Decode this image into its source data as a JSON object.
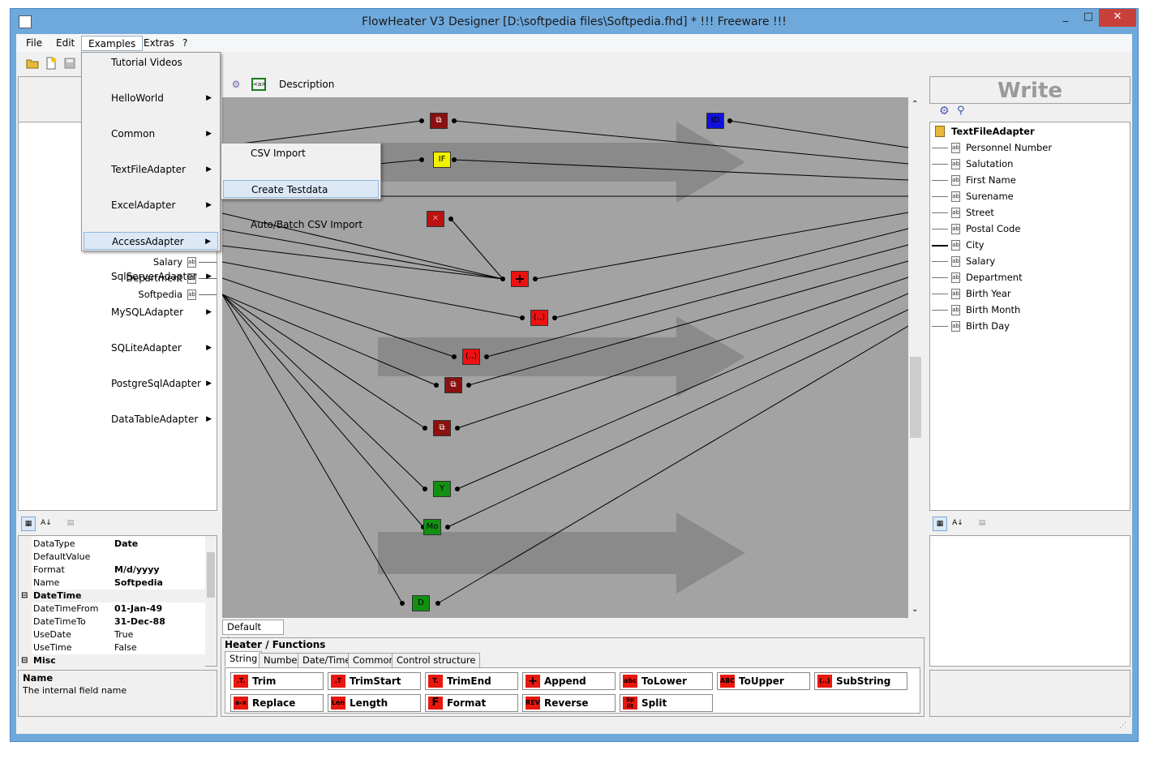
{
  "window": {
    "title": "FlowHeater V3 Designer [D:\\softpedia files\\Softpedia.fhd] * !!! Freeware !!!",
    "minimize": "_",
    "maximize": "□",
    "close": "✕"
  },
  "menubar": [
    "File",
    "Edit",
    "Examples",
    "Extras",
    "?"
  ],
  "examples_menu": {
    "items": [
      {
        "label": "Tutorial Videos",
        "submenu": false
      },
      {
        "label": "HelloWorld",
        "submenu": true
      },
      {
        "label": "Common",
        "submenu": true
      },
      {
        "label": "TextFileAdapter",
        "submenu": true
      },
      {
        "label": "ExcelAdapter",
        "submenu": true
      },
      {
        "label": "AccessAdapter",
        "submenu": true
      },
      {
        "label": "SqlServerAdapter",
        "submenu": true
      },
      {
        "label": "MySQLAdapter",
        "submenu": true
      },
      {
        "label": "SQLiteAdapter",
        "submenu": true
      },
      {
        "label": "PostgreSqlAdapter",
        "submenu": true
      },
      {
        "label": "DataTableAdapter",
        "submenu": true
      }
    ],
    "submenu_items": [
      "CSV Import",
      "Create Testdata",
      "Auto/Batch CSV Import"
    ]
  },
  "canvas_toolbar": {
    "description": "Description"
  },
  "left_fields": [
    "Salary",
    "Department",
    "Softpedia"
  ],
  "properties": {
    "rows": [
      {
        "key": "DataType",
        "value": "Date",
        "bold": true
      },
      {
        "key": "DefaultValue",
        "value": "",
        "bold": false
      },
      {
        "key": "Format",
        "value": "M/d/yyyy",
        "bold": true
      },
      {
        "key": "Name",
        "value": "Softpedia",
        "bold": true
      }
    ],
    "cat_datetime": "DateTime",
    "datetime_rows": [
      {
        "key": "DateTimeFrom",
        "value": "01-Jan-49",
        "bold": true
      },
      {
        "key": "DateTimeTo",
        "value": "31-Dec-88",
        "bold": true
      },
      {
        "key": "UseDate",
        "value": "True",
        "bold": false
      },
      {
        "key": "UseTime",
        "value": "False",
        "bold": false
      }
    ],
    "cat_misc": "Misc",
    "help_title": "Name",
    "help_text": "The internal field name"
  },
  "write_panel": {
    "header": "Write",
    "adapter": "TextFileAdapter",
    "fields": [
      "Personnel Number",
      "Salutation",
      "First Name",
      "Surename",
      "Street",
      "Postal Code",
      "City",
      "Salary",
      "Department",
      "Birth Year",
      "Birth Month",
      "Birth Day"
    ]
  },
  "nodes": {
    "if": "IF",
    "id": "ID",
    "y": "Y",
    "mo": "Mo",
    "d": "D",
    "substr": "(..)"
  },
  "layer_tab": "Default Layer",
  "functions": {
    "header": "Heater / Functions",
    "tabs": [
      "String",
      "Number",
      "Date/Time",
      "Common",
      "Control structure"
    ],
    "buttons": [
      {
        "label": "Trim",
        "icon": ".T."
      },
      {
        "label": "TrimStart",
        "icon": ".T"
      },
      {
        "label": "TrimEnd",
        "icon": "T."
      },
      {
        "label": "Append",
        "icon": "+"
      },
      {
        "label": "ToLower",
        "icon": "abc"
      },
      {
        "label": "ToUpper",
        "icon": "ABC"
      },
      {
        "label": "SubString",
        "icon": "(..)"
      },
      {
        "label": "Replace",
        "icon": "a-x"
      },
      {
        "label": "Length",
        "icon": "Len"
      },
      {
        "label": "Format",
        "icon": "F"
      },
      {
        "label": "Reverse",
        "icon": "REV"
      },
      {
        "label": "Split",
        "icon": "Sp lit"
      }
    ]
  },
  "colors": {
    "canvas": "#a3a3a3",
    "node_dark_red": "#8b1010",
    "node_red": "#ee1111",
    "node_yellow": "#f2f200",
    "node_blue": "#1111dd",
    "node_green": "#129012",
    "titlebar": "#6fa9dc"
  }
}
